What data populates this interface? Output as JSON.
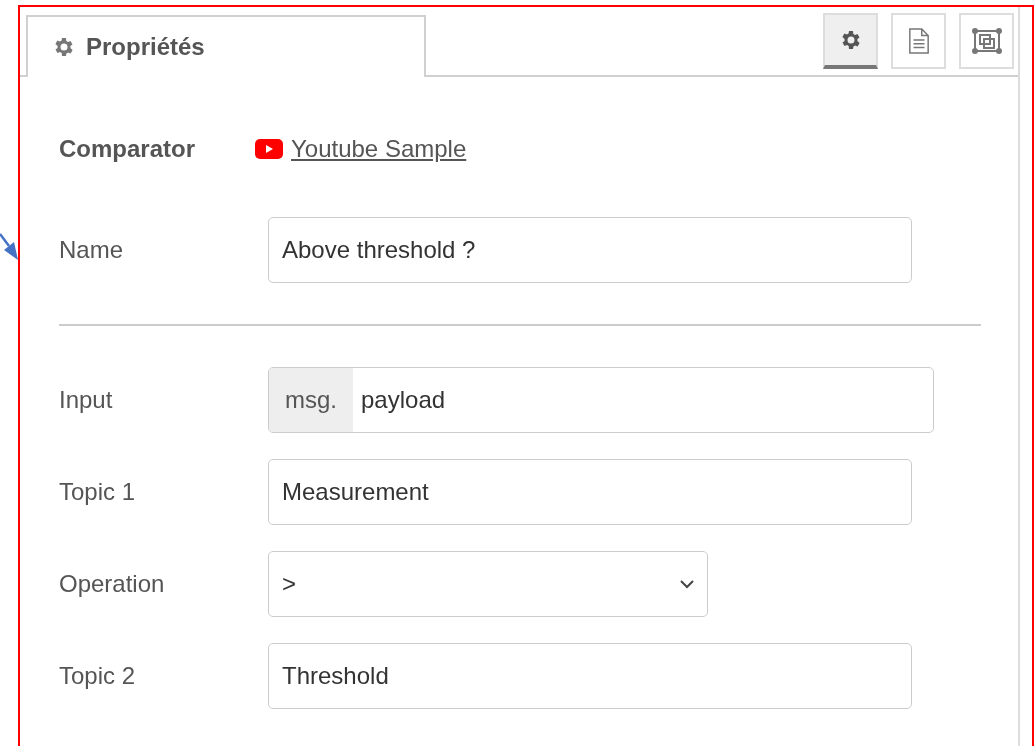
{
  "tabs": [
    {
      "label": "Propriétés",
      "selected": true
    }
  ],
  "toolbar": [
    {
      "kind": "settings",
      "selected": true
    },
    {
      "kind": "info",
      "selected": false
    },
    {
      "kind": "layout",
      "selected": false
    }
  ],
  "node": {
    "type": "Comparator",
    "link": "Youtube Sample"
  },
  "name": {
    "label": "Name",
    "value": "Above threshold ?"
  },
  "fields": [
    {
      "kind": "typed",
      "label": "Input",
      "prefix": "msg.",
      "value": "payload"
    },
    {
      "kind": "text",
      "label": "Topic 1",
      "value": "Measurement"
    },
    {
      "kind": "select",
      "label": "Operation",
      "value": ">"
    },
    {
      "kind": "text",
      "label": "Topic 2",
      "value": "Threshold"
    }
  ]
}
